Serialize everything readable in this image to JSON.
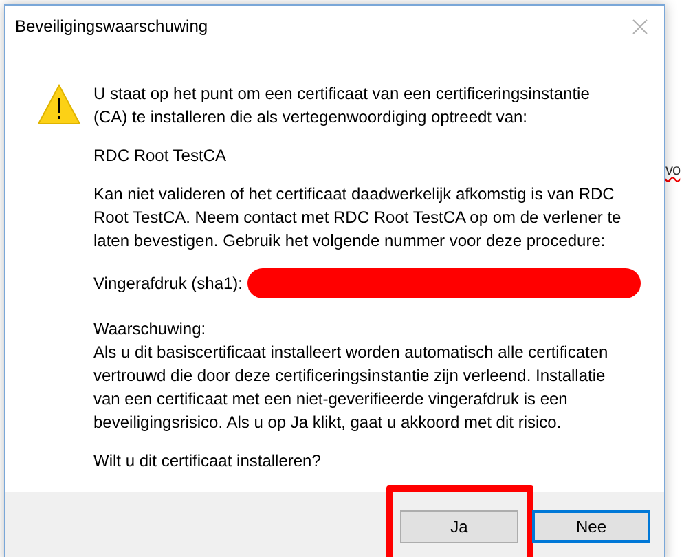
{
  "window": {
    "title": "Beveiligingswaarschuwing"
  },
  "background_text": "vo",
  "paragraphs": [
    {
      "kind": "text",
      "text": "U staat op het punt om een certificaat van een certificeringsinstantie (CA) te installeren die als vertegenwoordiging optreedt van:"
    },
    {
      "kind": "text",
      "text": "RDC Root TestCA"
    },
    {
      "kind": "text",
      "text": "Kan niet valideren of het certificaat daadwerkelijk afkomstig is van RDC Root TestCA. Neem contact met RDC Root TestCA op om de verlener te laten bevestigen. Gebruik het volgende nummer voor deze procedure:"
    },
    {
      "kind": "fingerprint",
      "label": "Vingerafdruk (sha1):",
      "redacted": true
    },
    {
      "kind": "warning",
      "heading": "Waarschuwing:",
      "text": "Als u dit basiscertificaat installeert worden automatisch alle certificaten vertrouwd die door deze certificeringsinstantie zijn verleend. Installatie van een certificaat met een niet-geverifieerde vingerafdruk is een beveiligingsrisico. Als u op Ja klikt, gaat u akkoord met dit risico."
    },
    {
      "kind": "text",
      "text": "Wilt u dit certificaat installeren?"
    }
  ],
  "buttons": [
    {
      "label": "Ja",
      "default": false,
      "highlighted": true
    },
    {
      "label": "Nee",
      "default": true,
      "highlighted": false
    }
  ]
}
